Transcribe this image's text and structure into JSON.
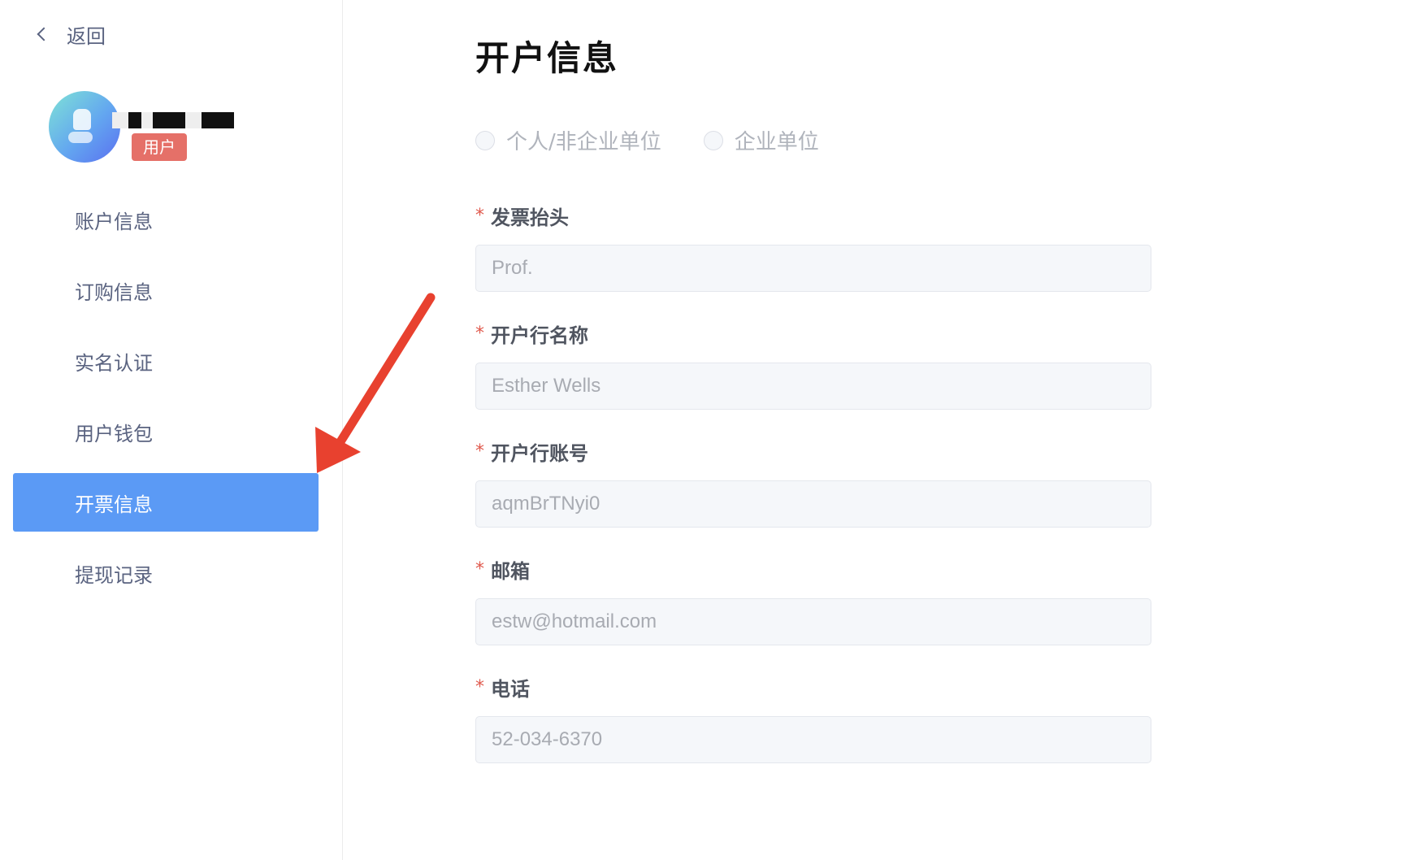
{
  "sidebar": {
    "back_label": "返回",
    "user_role_badge": "用户",
    "items": [
      {
        "label": "账户信息",
        "active": false
      },
      {
        "label": "订购信息",
        "active": false
      },
      {
        "label": "实名认证",
        "active": false
      },
      {
        "label": "用户钱包",
        "active": false
      },
      {
        "label": "开票信息",
        "active": true
      },
      {
        "label": "提现记录",
        "active": false
      }
    ]
  },
  "main": {
    "title": "开户信息",
    "entity_type_options": [
      {
        "label": "个人/非企业单位",
        "selected": false
      },
      {
        "label": "企业单位",
        "selected": false
      }
    ],
    "fields": [
      {
        "label": "发票抬头",
        "required": true,
        "value": "Prof."
      },
      {
        "label": "开户行名称",
        "required": true,
        "value": "Esther Wells"
      },
      {
        "label": "开户行账号",
        "required": true,
        "value": "aqmBrTNyi0"
      },
      {
        "label": "邮箱",
        "required": true,
        "value": "estw@hotmail.com"
      },
      {
        "label": "电话",
        "required": true,
        "value": "52-034-6370"
      }
    ],
    "required_marker": "*"
  },
  "colors": {
    "active_nav_bg": "#5b9af5",
    "badge_bg": "#e57068",
    "required_star": "#e05a4e",
    "annotation_arrow": "#e8412f"
  }
}
